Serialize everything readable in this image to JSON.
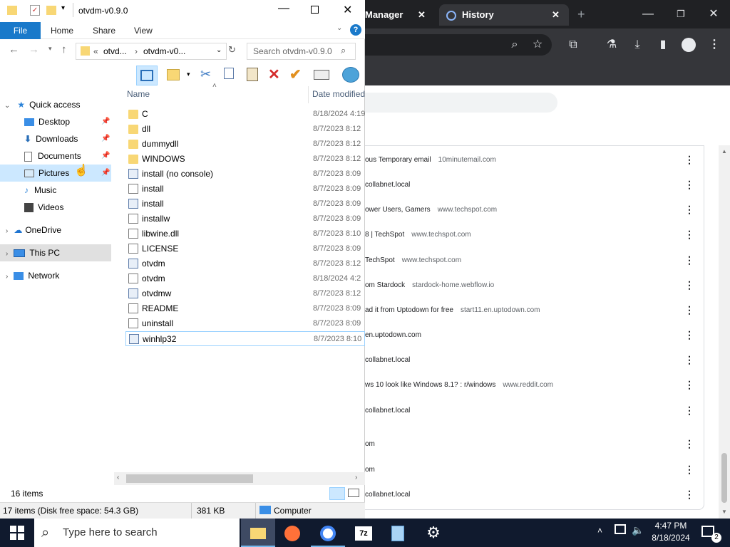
{
  "chrome": {
    "tab_manager": "Manager",
    "tab_history": "History",
    "close": "✕",
    "new_tab": "+",
    "history_rows": [
      {
        "title": "ous Temporary email",
        "domain": "10minutemail.com"
      },
      {
        "title": "collabnet.local",
        "domain": ""
      },
      {
        "title": "ower Users, Gamers",
        "domain": "www.techspot.com"
      },
      {
        "title": "8 | TechSpot",
        "domain": "www.techspot.com"
      },
      {
        "title": "TechSpot",
        "domain": "www.techspot.com"
      },
      {
        "title": "om Stardock",
        "domain": "stardock-home.webflow.io"
      },
      {
        "title": "ad it from Uptodown for free",
        "domain": "start11.en.uptodown.com"
      },
      {
        "title": "en.uptodown.com",
        "domain": ""
      },
      {
        "title": "collabnet.local",
        "domain": ""
      },
      {
        "title": "ws 10 look like Windows 8.1? : r/windows",
        "domain": "www.reddit.com"
      },
      {
        "title": "collabnet.local",
        "domain": ""
      },
      {
        "title": "om",
        "domain": ""
      },
      {
        "title": "om",
        "domain": ""
      },
      {
        "title": "collabnet.local",
        "domain": ""
      }
    ]
  },
  "explorer": {
    "title": "otvdm-v0.9.0",
    "ribbon_tabs": [
      "File",
      "Home",
      "Share",
      "View"
    ],
    "breadcrumb": [
      "«",
      "otvd...",
      "›",
      "otvdm-v0..."
    ],
    "search_placeholder": "Search otvdm-v0.9.0",
    "col_name": "Name",
    "col_date": "Date modified",
    "nav": {
      "quick_access": "Quick access",
      "desktop": "Desktop",
      "downloads": "Downloads",
      "documents": "Documents",
      "pictures": "Pictures",
      "music": "Music",
      "videos": "Videos",
      "onedrive": "OneDrive",
      "this_pc": "This PC",
      "network": "Network"
    },
    "files": [
      {
        "name": "C",
        "date": "8/18/2024 4:19",
        "type": "folder"
      },
      {
        "name": "dll",
        "date": "8/7/2023 8:12",
        "type": "folder"
      },
      {
        "name": "dummydll",
        "date": "8/7/2023 8:12",
        "type": "folder"
      },
      {
        "name": "WINDOWS",
        "date": "8/7/2023 8:12",
        "type": "folder"
      },
      {
        "name": "install (no console)",
        "date": "8/7/2023 8:09",
        "type": "app"
      },
      {
        "name": "install",
        "date": "8/7/2023 8:09",
        "type": "doc"
      },
      {
        "name": "install",
        "date": "8/7/2023 8:09",
        "type": "app"
      },
      {
        "name": "installw",
        "date": "8/7/2023 8:09",
        "type": "doc"
      },
      {
        "name": "libwine.dll",
        "date": "8/7/2023 8:10",
        "type": "doc"
      },
      {
        "name": "LICENSE",
        "date": "8/7/2023 8:09",
        "type": "doc"
      },
      {
        "name": "otvdm",
        "date": "8/7/2023 8:12",
        "type": "app"
      },
      {
        "name": "otvdm",
        "date": "8/18/2024 4:2",
        "type": "doc"
      },
      {
        "name": "otvdmw",
        "date": "8/7/2023 8:12",
        "type": "app"
      },
      {
        "name": "README",
        "date": "8/7/2023 8:09",
        "type": "doc"
      },
      {
        "name": "uninstall",
        "date": "8/7/2023 8:09",
        "type": "doc"
      },
      {
        "name": "winhlp32",
        "date": "8/7/2023 8:10",
        "type": "app"
      }
    ],
    "status_items": "16 items",
    "status_disk": "17 items (Disk free space: 54.3 GB)",
    "status_size": "381 KB",
    "status_location": "Computer"
  },
  "taskbar": {
    "search_placeholder": "Type here to search",
    "app_7z": "7z",
    "time": "4:47 PM",
    "date": "8/18/2024",
    "notifications": "2"
  },
  "colors": {
    "accent": "#1979ca",
    "chrome_dark": "#202124",
    "taskbar": "#101a2e"
  }
}
